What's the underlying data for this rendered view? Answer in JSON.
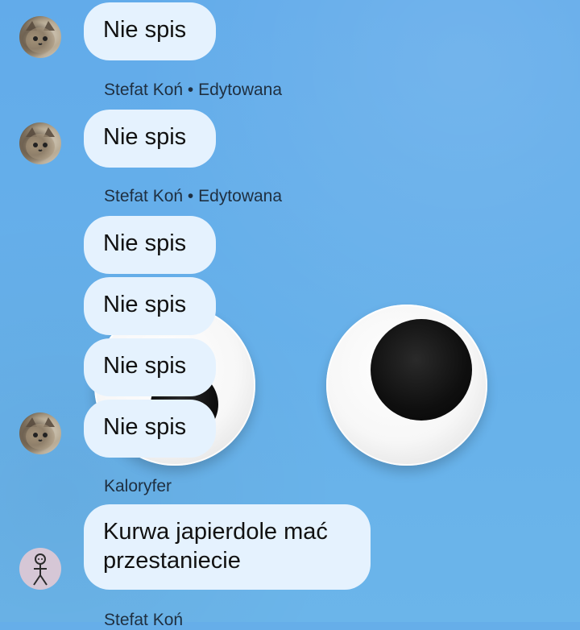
{
  "messages": [
    {
      "type": "bubble",
      "text": "Nie spis"
    },
    {
      "type": "sender",
      "name": "Stefat Koń",
      "meta": "Edytowana"
    },
    {
      "type": "bubble",
      "text": "Nie spis"
    },
    {
      "type": "sender",
      "name": "Stefat Koń",
      "meta": "Edytowana"
    },
    {
      "type": "bubble",
      "text": "Nie spis"
    },
    {
      "type": "bubble",
      "text": "Nie spis"
    },
    {
      "type": "bubble",
      "text": "Nie spis"
    },
    {
      "type": "bubble",
      "text": "Nie spis"
    },
    {
      "type": "sender",
      "name": "Kaloryfer"
    },
    {
      "type": "bubble",
      "text_lines": [
        "Kurwa japierdole mać",
        "przestaniecie"
      ]
    },
    {
      "type": "sender",
      "name": "Stefat Koń"
    }
  ],
  "ui": {
    "sender_separator": "•"
  },
  "colors": {
    "background": "#66aee9",
    "bubble": "#e5f2fe",
    "text": "#111111",
    "sender_text": "#1f2f40"
  },
  "icons": {
    "avatar_cat": "cat-avatar-icon",
    "avatar_stick": "stick-figure-avatar-icon"
  }
}
